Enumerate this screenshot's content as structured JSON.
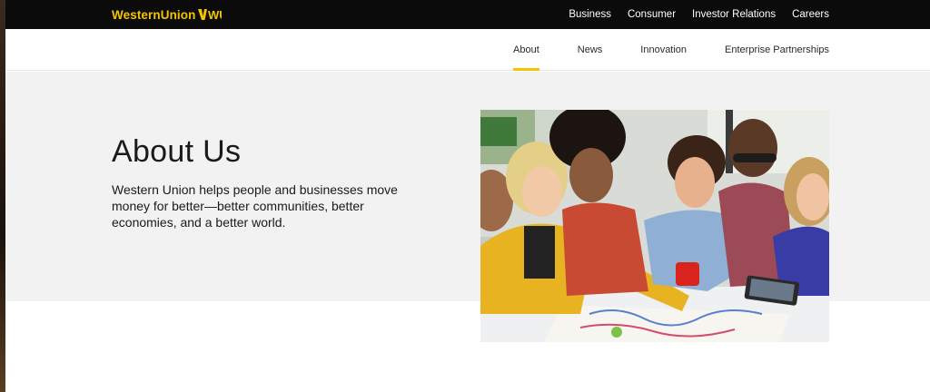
{
  "brand": {
    "name": "WesternUnion",
    "mark": "WU",
    "accent": "#f5c400"
  },
  "top_nav": [
    {
      "label": "Business"
    },
    {
      "label": "Consumer"
    },
    {
      "label": "Investor Relations"
    },
    {
      "label": "Careers"
    }
  ],
  "sub_nav": [
    {
      "label": "About",
      "active": true
    },
    {
      "label": "News",
      "active": false
    },
    {
      "label": "Innovation",
      "active": false
    },
    {
      "label": "Enterprise Partnerships",
      "active": false
    }
  ],
  "hero": {
    "title": "About Us",
    "description": "Western Union helps people and businesses move money for better—better communities, better economies, and a better world.",
    "image": "team-collaboration-photo"
  }
}
